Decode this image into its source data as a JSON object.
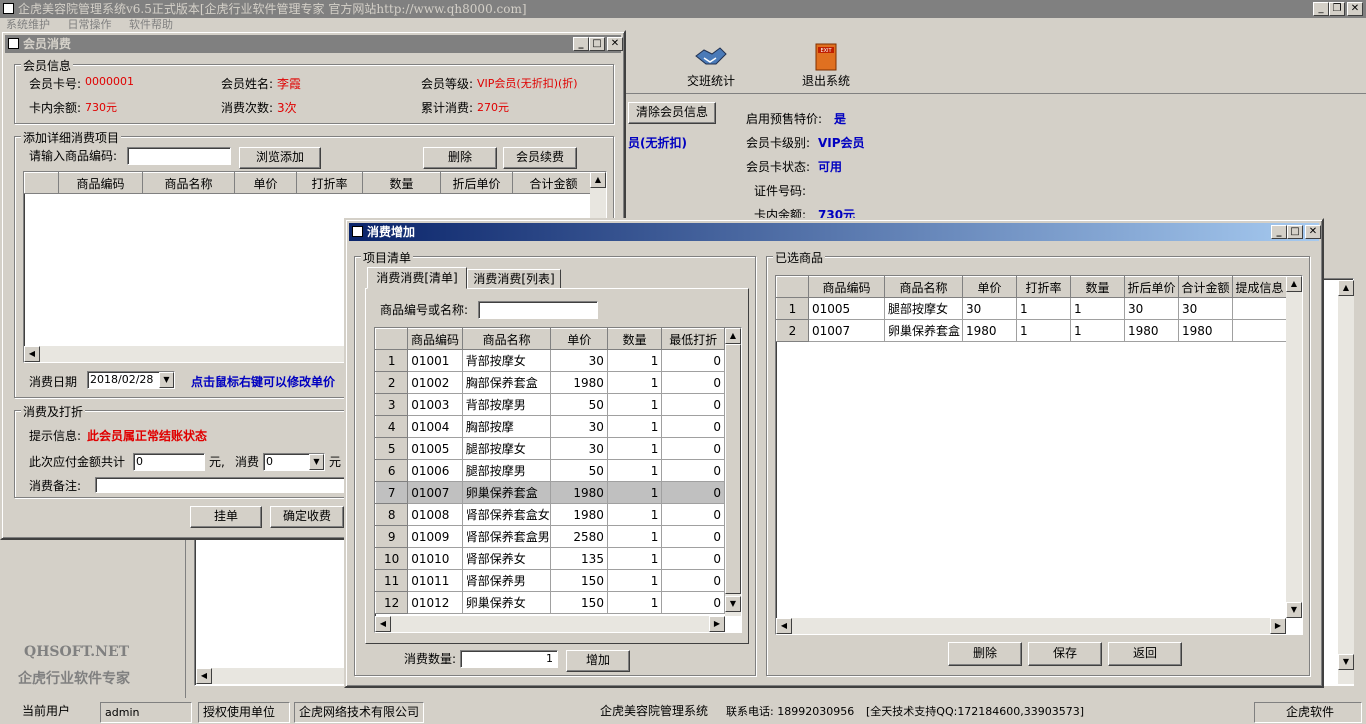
{
  "main_window": {
    "title": "企虎美容院管理系统v6.5正式版本[企虎行业软件管理专家 官方网站http://www.qh8000.com]",
    "menu": [
      "系统维护",
      "日常操作",
      "软件帮助"
    ],
    "toolbar": {
      "shift_stats": "交班统计",
      "exit": "退出系统"
    },
    "right_panel": {
      "clear_member_btn": "清除会员信息",
      "member_level_partial": "员(无折扣)",
      "presale_label": "启用预售特价:",
      "presale_value": "是",
      "card_level_label": "会员卡级别:",
      "card_level_value": "VIP会员",
      "card_status_label": "会员卡状态:",
      "card_status_value": "可用",
      "id_label": "证件号码:",
      "balance_label": "卡内余额:",
      "balance_value": "730元"
    },
    "watermark": {
      "line1": "QHSOFT.NET",
      "line2": "企虎行业软件专家"
    }
  },
  "member_dialog": {
    "title": "会员消费",
    "info_group": "会员信息",
    "card_no_label": "会员卡号:",
    "card_no": "0000001",
    "name_label": "会员姓名:",
    "name": "李霞",
    "level_label": "会员等级:",
    "level": "VIP会员(无折扣)(折)",
    "balance_label": "卡内余额:",
    "balance": "730元",
    "times_label": "消费次数:",
    "times": "3次",
    "total_label": "累计消费:",
    "total": "270元",
    "items_group": "添加详细消费项目",
    "code_label": "请输入商品编码:",
    "browse_btn": "浏览添加",
    "delete_btn": "删除",
    "renew_btn": "会员续费",
    "columns": [
      "商品编码",
      "商品名称",
      "单价",
      "打折率",
      "数量",
      "折后单价",
      "合计金额"
    ],
    "date_label": "消费日期",
    "date": "2018/02/28",
    "hint": "点击鼠标右键可以修改单价",
    "pay_group": "消费及打折",
    "tip_label": "提示信息:",
    "tip": "此会员属正常结账状态",
    "due_label": "此次应付金额共计",
    "due_value": "0",
    "yuan": "元,",
    "consume_label": "消费",
    "consume_value": "0",
    "yuan2": "元",
    "remark_label": "消费备注:",
    "hang_btn": "挂单",
    "confirm_btn": "确定收费"
  },
  "add_dialog": {
    "title": "消费增加",
    "list_group": "项目清单",
    "tabs": [
      "消费消费[清单]",
      "消费消费[列表]"
    ],
    "search_label": "商品编号或名称:",
    "search_value": "",
    "columns": [
      "商品编码",
      "商品名称",
      "单价",
      "数量",
      "最低打折"
    ],
    "rows": [
      {
        "no": "1",
        "code": "01001",
        "name": "背部按摩女",
        "price": "30",
        "qty": "1",
        "min": "0"
      },
      {
        "no": "2",
        "code": "01002",
        "name": "胸部保养套盒",
        "price": "1980",
        "qty": "1",
        "min": "0"
      },
      {
        "no": "3",
        "code": "01003",
        "name": "背部按摩男",
        "price": "50",
        "qty": "1",
        "min": "0"
      },
      {
        "no": "4",
        "code": "01004",
        "name": "胸部按摩",
        "price": "30",
        "qty": "1",
        "min": "0"
      },
      {
        "no": "5",
        "code": "01005",
        "name": "腿部按摩女",
        "price": "30",
        "qty": "1",
        "min": "0"
      },
      {
        "no": "6",
        "code": "01006",
        "name": "腿部按摩男",
        "price": "50",
        "qty": "1",
        "min": "0"
      },
      {
        "no": "7",
        "code": "01007",
        "name": "卵巢保养套盒",
        "price": "1980",
        "qty": "1",
        "min": "0"
      },
      {
        "no": "8",
        "code": "01008",
        "name": "肾部保养套盒女",
        "price": "1980",
        "qty": "1",
        "min": "0"
      },
      {
        "no": "9",
        "code": "01009",
        "name": "肾部保养套盒男",
        "price": "2580",
        "qty": "1",
        "min": "0"
      },
      {
        "no": "10",
        "code": "01010",
        "name": "肾部保养女",
        "price": "135",
        "qty": "1",
        "min": "0"
      },
      {
        "no": "11",
        "code": "01011",
        "name": "肾部保养男",
        "price": "150",
        "qty": "1",
        "min": "0"
      },
      {
        "no": "12",
        "code": "01012",
        "name": "卵巢保养女",
        "price": "150",
        "qty": "1",
        "min": "0"
      }
    ],
    "qty_label": "消费数量:",
    "qty_value": "1",
    "add_btn": "增加",
    "selected_group": "已选商品",
    "sel_columns": [
      "商品编码",
      "商品名称",
      "单价",
      "打折率",
      "数量",
      "折后单价",
      "合计金额",
      "提成信息"
    ],
    "sel_rows": [
      {
        "no": "1",
        "code": "01005",
        "name": "腿部按摩女",
        "price": "30",
        "disc": "1",
        "qty": "1",
        "after": "30",
        "total": "30",
        "comm": ""
      },
      {
        "no": "2",
        "code": "01007",
        "name": "卵巢保养套盒",
        "price": "1980",
        "disc": "1",
        "qty": "1",
        "after": "1980",
        "total": "1980",
        "comm": ""
      }
    ],
    "delete_btn": "删除",
    "save_btn": "保存",
    "back_btn": "返回"
  },
  "statusbar": {
    "user_label": "当前用户",
    "user": "admin",
    "licensed_label": "授权使用单位",
    "company": "企虎网络技术有限公司",
    "app": "企虎美容院管理系统",
    "phone": "联系电话: 18992030956",
    "support": "[全天技术支持QQ:172184600,33903573]",
    "brand": "企虎软件"
  },
  "colors": {
    "active_title": "#0a246a",
    "active_title_end": "#a6caf0",
    "inactive_title": "#808080",
    "red_value": "#e00000",
    "blue_value": "#0000c0"
  }
}
